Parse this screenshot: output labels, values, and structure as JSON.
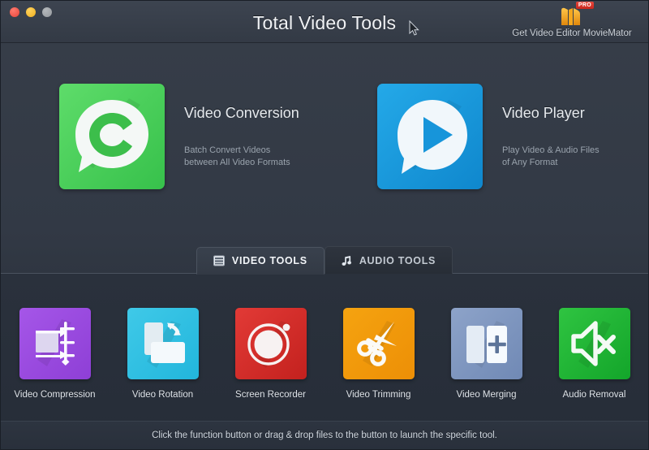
{
  "window": {
    "title": "Total Video Tools",
    "traffic_lights": [
      "close",
      "minimize",
      "zoom"
    ]
  },
  "promo": {
    "label": "Get Video Editor MovieMator",
    "badge": "PRO",
    "icon": "moviemator-logo-icon"
  },
  "featured": [
    {
      "title": "Video Conversion",
      "subtitle_line1": "Batch Convert Videos",
      "subtitle_line2": "between All Video Formats",
      "icon": "video-conversion-icon",
      "color": "#44cf55"
    },
    {
      "title": "Video Player",
      "subtitle_line1": "Play Video & Audio Files",
      "subtitle_line2": " of Any Format",
      "icon": "video-player-icon",
      "color": "#1795da"
    }
  ],
  "tabs": [
    {
      "label": "VIDEO TOOLS",
      "icon": "film-grid-icon",
      "active": true
    },
    {
      "label": "AUDIO TOOLS",
      "icon": "music-note-icon",
      "active": false
    }
  ],
  "tools": [
    {
      "label": "Video Compression",
      "icon": "compress-icon",
      "color": "#9a4ae0"
    },
    {
      "label": "Video Rotation",
      "icon": "rotate-icon",
      "color": "#2fc0de"
    },
    {
      "label": "Screen Recorder",
      "icon": "record-circle-icon",
      "color": "#d32b27"
    },
    {
      "label": "Video Trimming",
      "icon": "scissors-icon",
      "color": "#f19a0b"
    },
    {
      "label": "Video Merging",
      "icon": "merge-panels-icon",
      "color": "#7f96c0"
    },
    {
      "label": "Audio Removal",
      "icon": "speaker-mute-x-icon",
      "color": "#1fb434"
    }
  ],
  "statusbar": {
    "text": "Click the function button or drag & drop files to the button to launch the specific tool."
  }
}
